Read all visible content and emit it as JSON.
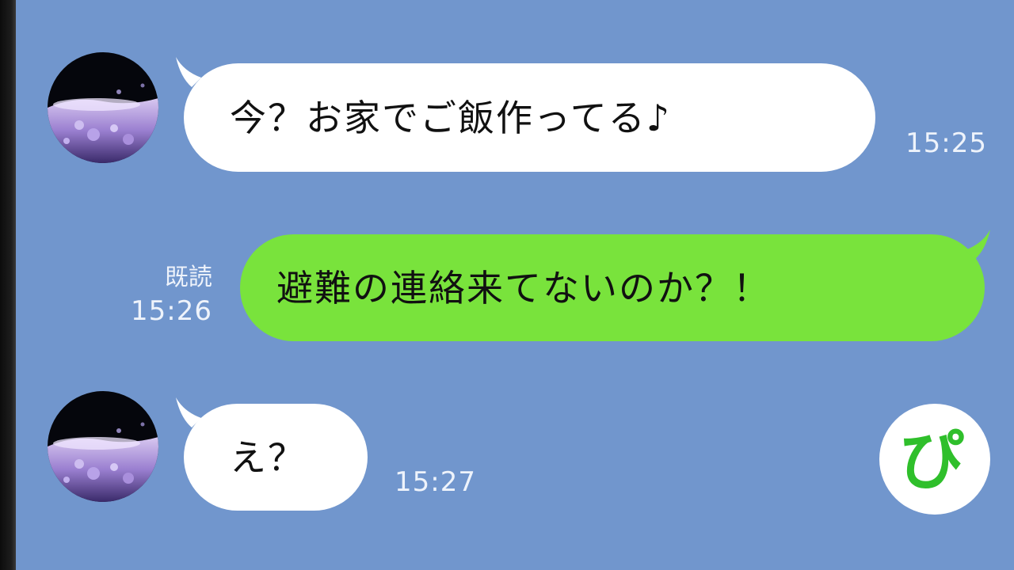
{
  "colors": {
    "background": "#7196cd",
    "incoming_bubble": "#ffffff",
    "outgoing_bubble": "#79e33c",
    "meta_text": "#eef3fb",
    "logo_green": "#2fbf2b"
  },
  "messages": [
    {
      "sender": "friend",
      "text": "今？お家でご飯作ってる♪",
      "time": "15:25"
    },
    {
      "sender": "me",
      "text": "避難の連絡来てないのか？！",
      "read_label": "既読",
      "time": "15:26"
    },
    {
      "sender": "friend",
      "text": "え？",
      "time": "15:27"
    }
  ],
  "logo": {
    "text": "ぴ",
    "icon": "pi-logo-icon"
  }
}
